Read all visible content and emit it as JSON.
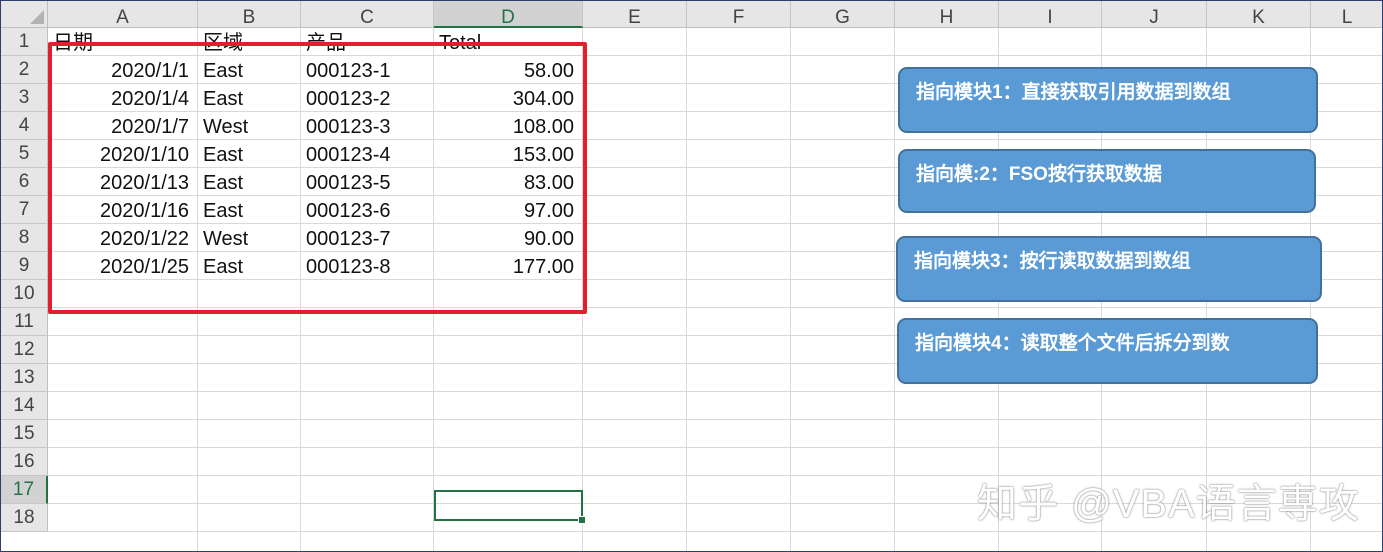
{
  "columns": [
    "A",
    "B",
    "C",
    "D",
    "E",
    "F",
    "G",
    "H",
    "I",
    "J",
    "K",
    "L"
  ],
  "rows": [
    "1",
    "2",
    "3",
    "4",
    "5",
    "6",
    "7",
    "8",
    "9",
    "10",
    "11",
    "12",
    "13",
    "14",
    "15",
    "16",
    "17",
    "18"
  ],
  "selected_column": "D",
  "selected_row": "17",
  "table": {
    "headers": [
      "日期",
      "区域",
      "产品",
      "Total"
    ],
    "data": [
      [
        "2020/1/1",
        "East",
        "000123-1",
        "58.00"
      ],
      [
        "2020/1/4",
        "East",
        "000123-2",
        "304.00"
      ],
      [
        "2020/1/7",
        "West",
        "000123-3",
        "108.00"
      ],
      [
        "2020/1/10",
        "East",
        "000123-4",
        "153.00"
      ],
      [
        "2020/1/13",
        "East",
        "000123-5",
        "83.00"
      ],
      [
        "2020/1/16",
        "East",
        "000123-6",
        "97.00"
      ],
      [
        "2020/1/22",
        "West",
        "000123-7",
        "90.00"
      ],
      [
        "2020/1/25",
        "East",
        "000123-8",
        "177.00"
      ]
    ]
  },
  "buttons": [
    {
      "label": "指向模块1：直接获取引用数据到数组"
    },
    {
      "label": "指向模:2：FSO按行获取数据"
    },
    {
      "label": "指向模块3：按行读取数据到数组"
    },
    {
      "label": "指向模块4：读取整个文件后拆分到数"
    }
  ],
  "watermark": "知乎 @VBA语言専攻",
  "colors": {
    "button_fill": "#5b9bd5",
    "highlight_border": "#e0202e",
    "selection": "#217346"
  }
}
